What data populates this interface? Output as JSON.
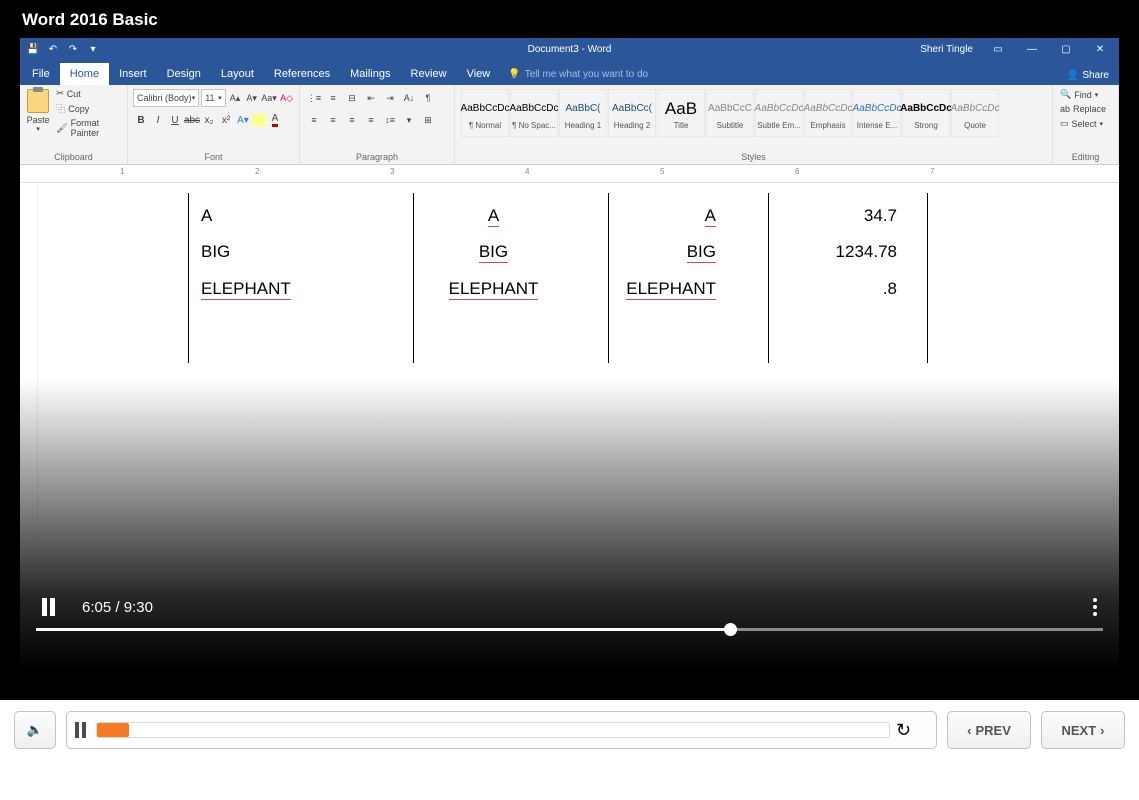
{
  "player": {
    "title": "Word 2016 Basic",
    "time_current": "6:05",
    "time_total": "9:30"
  },
  "word": {
    "doc_title": "Document3 - Word",
    "user_name": "Sheri Tingle",
    "tabs": {
      "file": "File",
      "home": "Home",
      "insert": "Insert",
      "design": "Design",
      "layout": "Layout",
      "references": "References",
      "mailings": "Mailings",
      "review": "Review",
      "view": "View"
    },
    "tellme": "Tell me what you want to do",
    "share": "Share",
    "clipboard": {
      "paste": "Paste",
      "cut": "Cut",
      "copy": "Copy",
      "format_painter": "Format Painter",
      "label": "Clipboard"
    },
    "font": {
      "name": "Calibri (Body)",
      "size": "11",
      "label": "Font"
    },
    "paragraph_label": "Paragraph",
    "styles_label": "Styles",
    "styles": [
      {
        "s": "AaBbCcDc",
        "l": "¶ Normal",
        "c": "#000"
      },
      {
        "s": "AaBbCcDc",
        "l": "¶ No Spac...",
        "c": "#000"
      },
      {
        "s": "AaBbC(",
        "l": "Heading 1",
        "c": "#1f4e79"
      },
      {
        "s": "AaBbCc(",
        "l": "Heading 2",
        "c": "#1f4e79"
      },
      {
        "s": "AaB",
        "l": "Title",
        "c": "#000",
        "sz": "17px"
      },
      {
        "s": "AaBbCcC",
        "l": "Subtitle",
        "c": "#888"
      },
      {
        "s": "AaBbCcDc",
        "l": "Subtle Em...",
        "c": "#888",
        "it": true
      },
      {
        "s": "AaBbCcDc",
        "l": "Emphasis",
        "c": "#888",
        "it": true
      },
      {
        "s": "AaBbCcDc",
        "l": "Intense E...",
        "c": "#2e74b5",
        "it": true
      },
      {
        "s": "AaBbCcDc",
        "l": "Strong",
        "c": "#000",
        "b": true
      },
      {
        "s": "AaBbCcDc",
        "l": "Quote",
        "c": "#888",
        "it": true
      }
    ],
    "editing": {
      "find": "Find",
      "replace": "Replace",
      "select": "Select",
      "label": "Editing"
    },
    "ruler_nums": [
      "1",
      "2",
      "3",
      "4",
      "5",
      "6",
      "7"
    ]
  },
  "doc": {
    "col1": [
      "A",
      "BIG",
      "ELEPHANT"
    ],
    "col2": [
      "A",
      "BIG",
      "ELEPHANT"
    ],
    "col3": [
      "A",
      "BIG",
      "ELEPHANT"
    ],
    "col4": [
      "34.7",
      "1234.78",
      ".8"
    ]
  },
  "bottom": {
    "prev": "PREV",
    "next": "NEXT"
  }
}
